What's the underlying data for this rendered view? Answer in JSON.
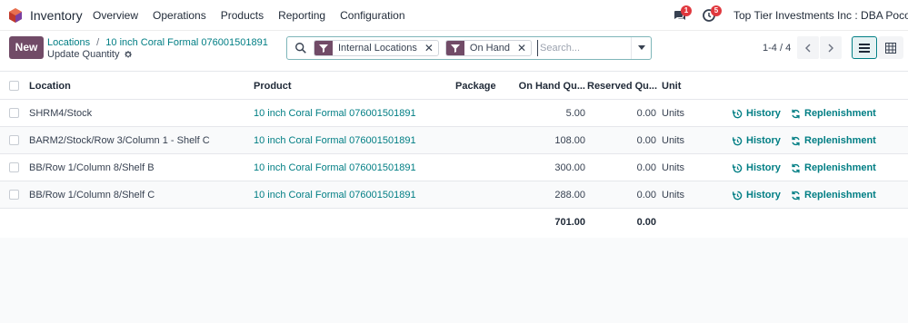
{
  "app": {
    "name": "Inventory",
    "logo_icon": "odoo-inventory-logo-icon"
  },
  "menu": [
    "Overview",
    "Operations",
    "Products",
    "Reporting",
    "Configuration"
  ],
  "navbar": {
    "messages_count": "1",
    "activities_count": "5",
    "company": "Top Tier Investments Inc : DBA Pocon..."
  },
  "control": {
    "new_label": "New",
    "breadcrumb": [
      "Locations",
      "10 inch Coral Formal 076001501891"
    ],
    "subtitle": "Update Quantity"
  },
  "search": {
    "facets": [
      "Internal Locations",
      "On Hand"
    ],
    "placeholder": "Search..."
  },
  "pager": {
    "text": "1-4 / 4"
  },
  "table": {
    "columns": [
      "Location",
      "Product",
      "Package",
      "On Hand Qu...",
      "Reserved Qu...",
      "Unit"
    ],
    "rows": [
      {
        "location": "SHRM4/Stock",
        "product": "10 inch Coral Formal 076001501891",
        "package": "",
        "on_hand": "5.00",
        "reserved": "0.00",
        "unit": "Units"
      },
      {
        "location": "BARM2/Stock/Row 3/Column 1 - Shelf C",
        "product": "10 inch Coral Formal 076001501891",
        "package": "",
        "on_hand": "108.00",
        "reserved": "0.00",
        "unit": "Units"
      },
      {
        "location": "BB/Row 1/Column 8/Shelf B",
        "product": "10 inch Coral Formal 076001501891",
        "package": "",
        "on_hand": "300.00",
        "reserved": "0.00",
        "unit": "Units"
      },
      {
        "location": "BB/Row 1/Column 8/Shelf C",
        "product": "10 inch Coral Formal 076001501891",
        "package": "",
        "on_hand": "288.00",
        "reserved": "0.00",
        "unit": "Units"
      }
    ],
    "actions": {
      "history": "History",
      "replenishment": "Replenishment"
    },
    "totals": {
      "on_hand": "701.00",
      "reserved": "0.00"
    }
  },
  "colors": {
    "brand": "#714b67",
    "link": "#017e84",
    "badge": "#e0383e"
  }
}
